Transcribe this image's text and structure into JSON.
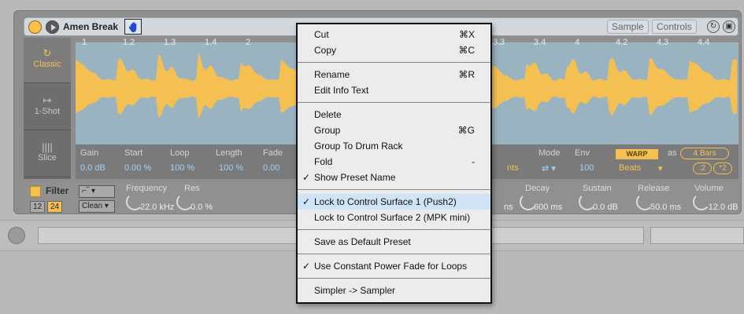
{
  "device": {
    "title": "Amen Break",
    "tabs": {
      "sample": "Sample",
      "controls": "Controls"
    },
    "icons": {
      "power": "power-icon",
      "play": "play-icon",
      "hand": "hand-icon"
    },
    "modes": [
      {
        "label": "Classic",
        "icon": "↻"
      },
      {
        "label": "1-Shot",
        "icon": "↦"
      },
      {
        "label": "Slice",
        "icon": "||||"
      }
    ],
    "ruler": [
      "1",
      "1.2",
      "1.3",
      "1.4",
      "2",
      "3.3",
      "3.4",
      "4",
      "4.2",
      "4.3",
      "4.4"
    ],
    "params": {
      "gain_label": "Gain",
      "gain": "0.0 dB",
      "start_label": "Start",
      "start": "0.00 %",
      "loop_label": "Loop",
      "loop": "100 %",
      "length_label": "Length",
      "length": "100 %",
      "fade_label": "Fade",
      "fade": "0.00",
      "mode_label": "Mode",
      "env_label": "Env",
      "env": "100",
      "partial_left": "nts",
      "warp": "WARP",
      "as_label": "as",
      "bars": "4 Bars",
      "beats": "Beats",
      "div2": ":2",
      "mul2": "*2"
    },
    "filter": {
      "label": "Filter",
      "num12": "12",
      "num24": "24",
      "clean": "Clean",
      "frequency_label": "Frequency",
      "frequency": "22.0 kHz",
      "res_label": "Res",
      "res": "0.0 %",
      "partial_ms": "ns",
      "decay_label": "Decay",
      "decay": "600 ms",
      "sustain_label": "Sustain",
      "sustain": "0.0 dB",
      "release_label": "Release",
      "release": "50.0 ms",
      "volume_label": "Volume",
      "volume": "-12.0 dB"
    }
  },
  "context_menu": {
    "groups": [
      [
        {
          "label": "Cut",
          "shortcut": "⌘X"
        },
        {
          "label": "Copy",
          "shortcut": "⌘C"
        }
      ],
      [
        {
          "label": "Rename",
          "shortcut": "⌘R"
        },
        {
          "label": "Edit Info Text",
          "shortcut": ""
        }
      ],
      [
        {
          "label": "Delete",
          "shortcut": ""
        },
        {
          "label": "Group",
          "shortcut": "⌘G"
        },
        {
          "label": "Group To Drum Rack",
          "shortcut": ""
        },
        {
          "label": "Fold",
          "shortcut": "-"
        },
        {
          "label": "Show Preset Name",
          "shortcut": "",
          "checked": true
        }
      ],
      [
        {
          "label": "Lock to Control Surface 1 (Push2)",
          "shortcut": "",
          "checked": true,
          "highlighted": true
        },
        {
          "label": "Lock to Control Surface 2 (MPK mini)",
          "shortcut": ""
        }
      ],
      [
        {
          "label": "Save as Default Preset",
          "shortcut": ""
        }
      ],
      [
        {
          "label": "Use Constant Power Fade for Loops",
          "shortcut": "",
          "checked": true
        }
      ],
      [
        {
          "label": "Simpler -> Sampler",
          "shortcut": ""
        }
      ]
    ],
    "check_glyph": "✓"
  }
}
